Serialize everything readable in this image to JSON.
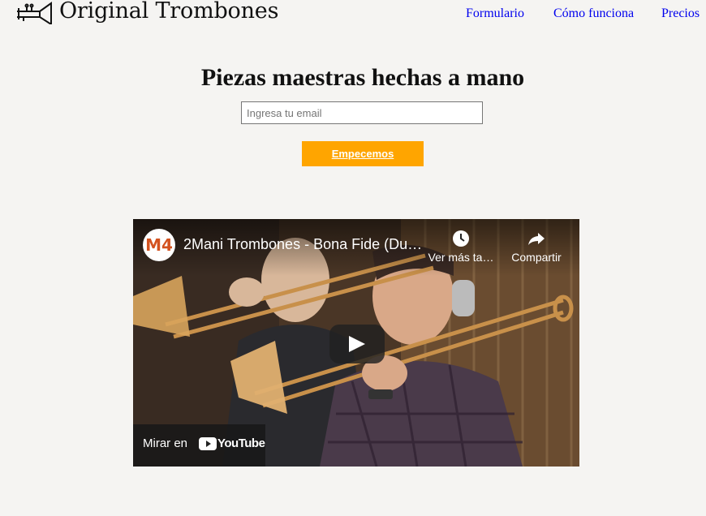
{
  "header": {
    "brand": "Original Trombones",
    "nav": [
      {
        "label": "Formulario"
      },
      {
        "label": "Cómo funciona"
      },
      {
        "label": "Precios"
      }
    ]
  },
  "hero": {
    "title": "Piezas maestras hechas a mano",
    "email_placeholder": "Ingresa tu email",
    "email_value": "",
    "cta_label": "Empecemos"
  },
  "video": {
    "channel_initials": "M4",
    "title": "2Mani Trombones - Bona Fide (Duo…",
    "watch_later_label": "Ver más ta…",
    "share_label": "Compartir",
    "watch_on_label": "Mirar en",
    "youtube_label": "YouTube"
  },
  "colors": {
    "accent": "#ffa500",
    "link": "#0000ee",
    "background": "#f5f4f2"
  }
}
